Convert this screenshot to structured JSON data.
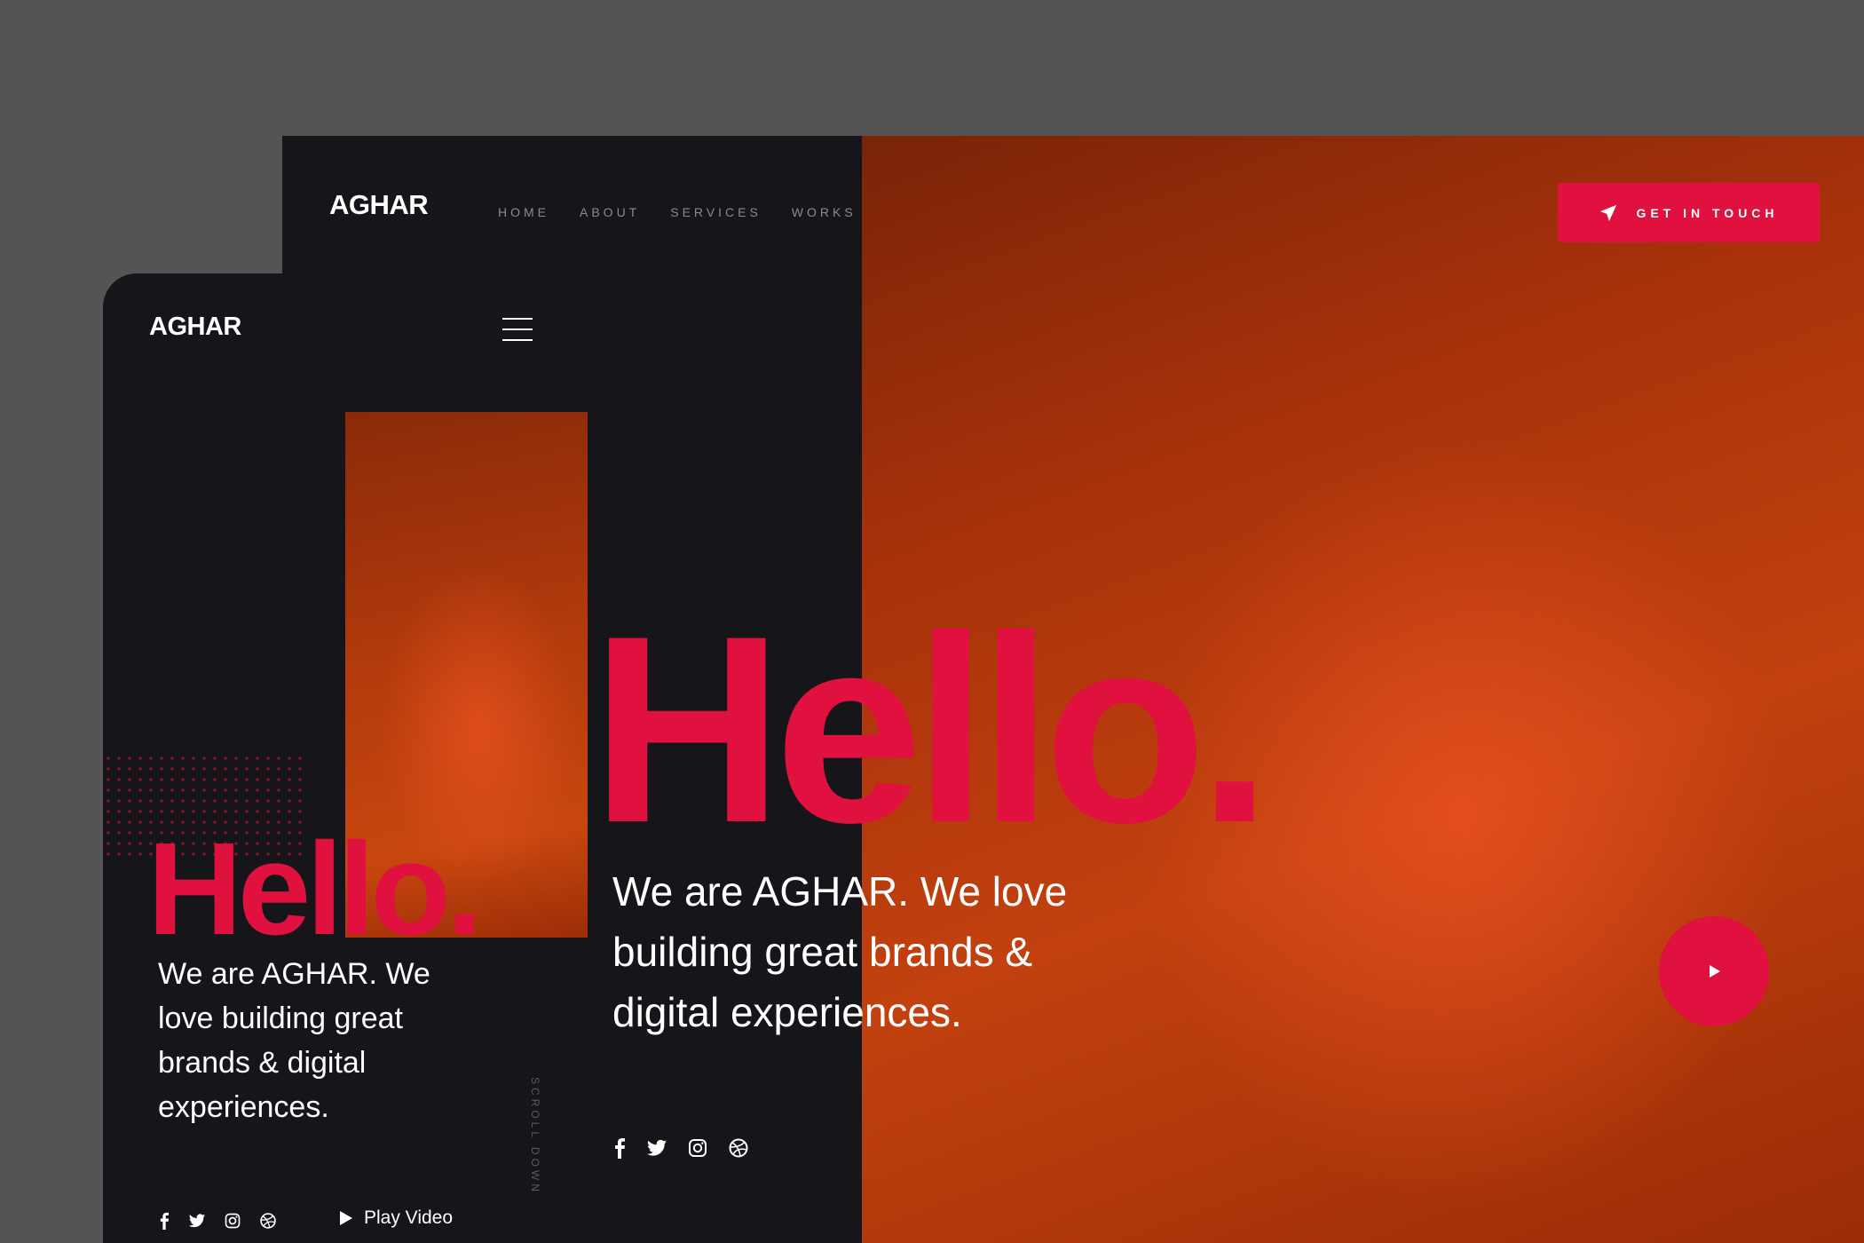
{
  "brand": {
    "name": "AGHAR"
  },
  "desktop": {
    "nav": [
      {
        "label": "HOME"
      },
      {
        "label": "ABOUT"
      },
      {
        "label": "SERVICES"
      },
      {
        "label": "WORKS"
      }
    ],
    "cta_label": "GET IN TOUCH",
    "hero_title": "Hello.",
    "tagline": "We are AGHAR. We love building great brands & digital experiences.",
    "social_icons": [
      "facebook-icon",
      "twitter-icon",
      "instagram-icon",
      "dribbble-icon"
    ]
  },
  "mobile": {
    "hero_title": "Hello.",
    "tagline": "We are AGHAR. We love building great brands & digital experiences.",
    "scroll_label": "SCROLL DOWN",
    "play_label": "Play Video",
    "social_icons": [
      "facebook-icon",
      "twitter-icon",
      "instagram-icon",
      "dribbble-icon"
    ]
  },
  "colors": {
    "accent": "#e0103f",
    "dark": "#15151a",
    "backdrop": "#545454",
    "photo_orange": "#c2410f"
  }
}
